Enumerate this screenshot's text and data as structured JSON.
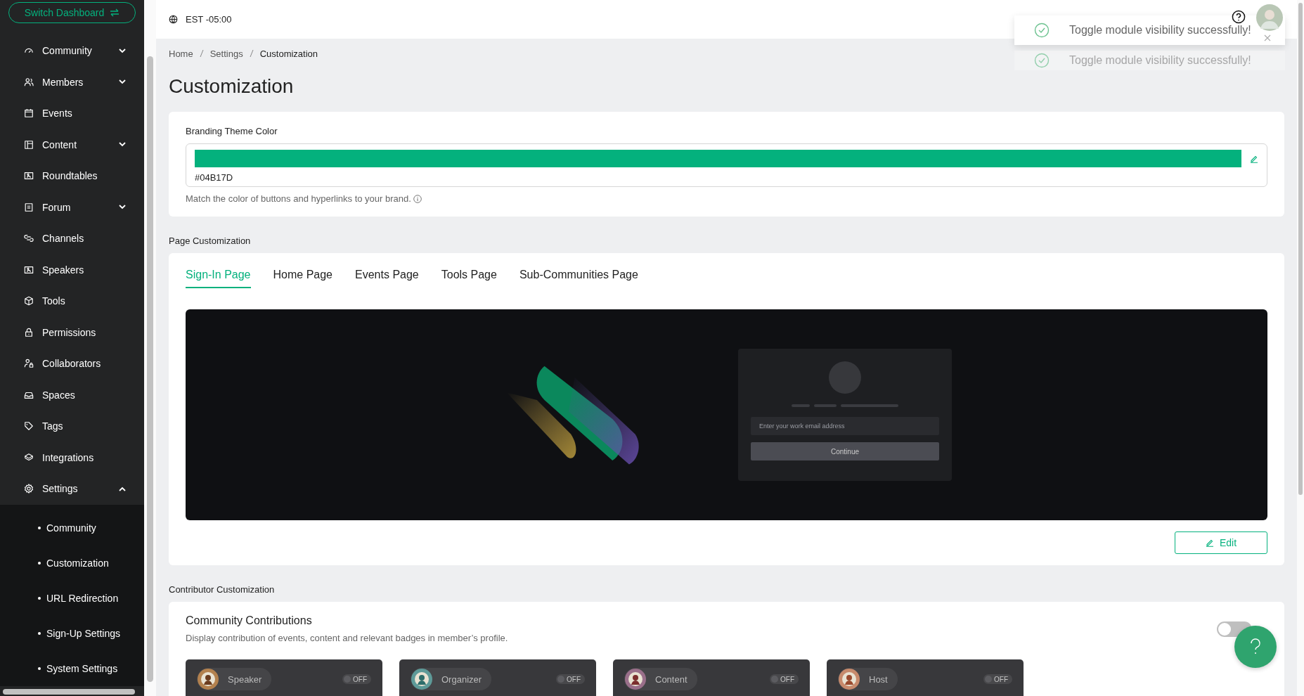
{
  "sidebar": {
    "switch_button": "Switch Dashboard",
    "items": [
      {
        "label": "Community",
        "expanded": false
      },
      {
        "label": "Members",
        "expanded": false
      },
      {
        "label": "Events"
      },
      {
        "label": "Content",
        "expanded": false
      },
      {
        "label": "Roundtables"
      },
      {
        "label": "Forum",
        "expanded": false
      },
      {
        "label": "Channels"
      },
      {
        "label": "Speakers"
      },
      {
        "label": "Tools"
      },
      {
        "label": "Permissions"
      },
      {
        "label": "Collaborators"
      },
      {
        "label": "Spaces"
      },
      {
        "label": "Tags"
      },
      {
        "label": "Integrations"
      },
      {
        "label": "Settings",
        "expanded": true,
        "children": [
          {
            "label": "Community"
          },
          {
            "label": "Customization"
          },
          {
            "label": "URL Redirection"
          },
          {
            "label": "Sign-Up Settings"
          },
          {
            "label": "System Settings"
          }
        ]
      }
    ]
  },
  "topbar": {
    "timezone": "EST -05:00"
  },
  "toasts": [
    {
      "text": "Toggle module visibility successfully!",
      "faded": false
    },
    {
      "text": "Toggle module visibility successfully!",
      "faded": true
    }
  ],
  "breadcrumb": [
    "Home",
    "Settings",
    "Customization"
  ],
  "title": "Customization",
  "branding": {
    "label": "Branding Theme Color",
    "value": "#04B17D",
    "hint": "Match the color of buttons and hyperlinks to your brand."
  },
  "page_customization": {
    "heading": "Page Customization",
    "tabs": [
      {
        "label": "Sign-In Page",
        "selected": true
      },
      {
        "label": "Home Page",
        "selected": false
      },
      {
        "label": "Events Page",
        "selected": false
      },
      {
        "label": "Tools Page",
        "selected": false
      },
      {
        "label": "Sub-Communities Page",
        "selected": false
      }
    ],
    "preview": {
      "email_placeholder": "Enter your work email address",
      "button": "Continue"
    },
    "edit_button": "Edit"
  },
  "contributor": {
    "heading": "Contributor Customization",
    "title": "Community Contributions",
    "description": "Display contribution of events, content and relevant badges in member’s profile.",
    "on": false,
    "badges": [
      {
        "label": "Speaker",
        "toggle": "OFF",
        "on": false
      },
      {
        "label": "Organizer",
        "toggle": "OFF",
        "on": false
      },
      {
        "label": "Content",
        "toggle": "OFF",
        "on": false
      },
      {
        "label": "Host",
        "toggle": "OFF",
        "on": false
      }
    ]
  }
}
